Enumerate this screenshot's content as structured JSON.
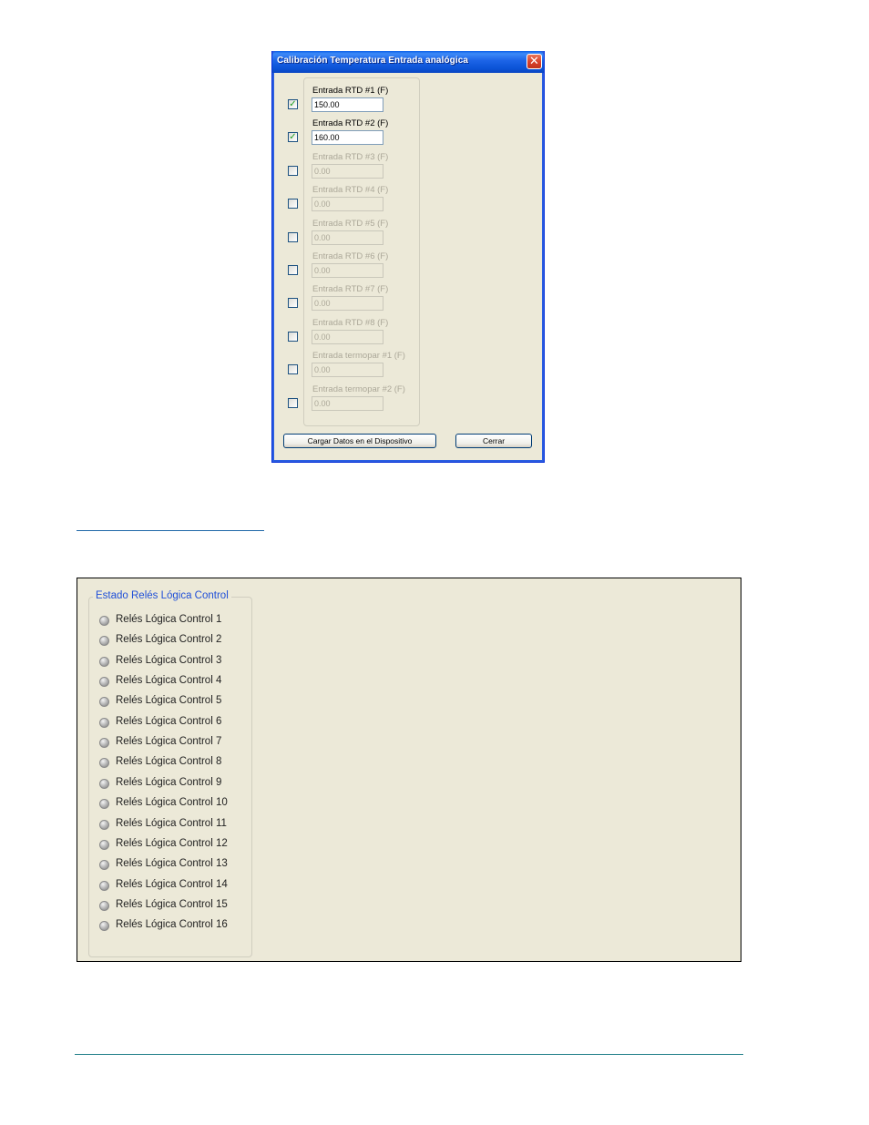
{
  "dialog": {
    "title": "Calibración Temperatura Entrada analógica",
    "close_glyph": "✕",
    "rows": [
      {
        "label": "Entrada RTD #1 (F)",
        "value": "150.00",
        "checked": true,
        "enabled": true
      },
      {
        "label": "Entrada RTD #2 (F)",
        "value": "160.00",
        "checked": true,
        "enabled": true
      },
      {
        "label": "Entrada RTD #3 (F)",
        "value": "0.00",
        "checked": false,
        "enabled": false
      },
      {
        "label": "Entrada RTD #4 (F)",
        "value": "0.00",
        "checked": false,
        "enabled": false
      },
      {
        "label": "Entrada RTD #5 (F)",
        "value": "0.00",
        "checked": false,
        "enabled": false
      },
      {
        "label": "Entrada RTD #6 (F)",
        "value": "0.00",
        "checked": false,
        "enabled": false
      },
      {
        "label": "Entrada RTD #7 (F)",
        "value": "0.00",
        "checked": false,
        "enabled": false
      },
      {
        "label": "Entrada RTD #8 (F)",
        "value": "0.00",
        "checked": false,
        "enabled": false
      },
      {
        "label": "Entrada termopar #1 (F)",
        "value": "0.00",
        "checked": false,
        "enabled": false
      },
      {
        "label": "Entrada termopar #2 (F)",
        "value": "0.00",
        "checked": false,
        "enabled": false
      }
    ],
    "load_button": "Cargar Datos en el Dispositivo",
    "close_button": "Cerrar"
  },
  "status_panel": {
    "group_title": "Estado Relés Lógica Control",
    "led_icon": "led-off-icon",
    "items": [
      "Relés Lógica Control 1",
      "Relés Lógica Control 2",
      "Relés Lógica Control 3",
      "Relés Lógica Control 4",
      "Relés Lógica Control 5",
      "Relés Lógica Control 6",
      "Relés Lógica Control 7",
      "Relés Lógica Control 8",
      "Relés Lógica Control 9",
      "Relés Lógica Control 10",
      "Relés Lógica Control 11",
      "Relés Lógica Control 12",
      "Relés Lógica Control 13",
      "Relés Lógica Control 14",
      "Relés Lógica Control 15",
      "Relés Lógica Control 16"
    ]
  },
  "colors": {
    "dialog_bg": "#ECE9D8",
    "titlebar": "#0A53D6",
    "legend_text": "#1F4FD8",
    "link_line": "#1F67A8",
    "footer_line": "#1E7D87"
  }
}
